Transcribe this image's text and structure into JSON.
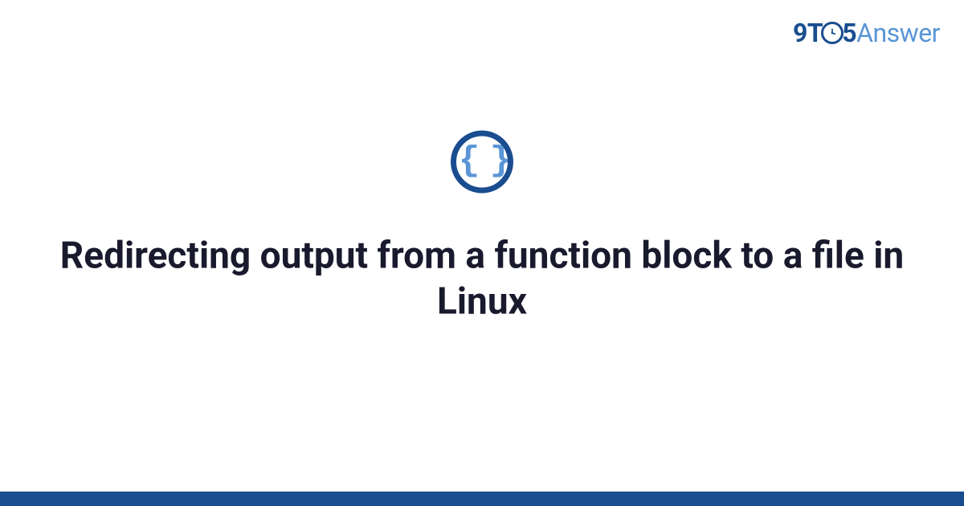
{
  "brand": {
    "part1": "9",
    "part2": "T",
    "part3": "5",
    "part4": "Answer"
  },
  "icon": {
    "name": "code-braces-icon",
    "glyph": "{ }"
  },
  "page": {
    "title": "Redirecting output from a function block to a file in Linux"
  },
  "colors": {
    "primary_dark": "#1a4d8f",
    "primary_light": "#5a95d6",
    "text": "#1a1a2e"
  }
}
